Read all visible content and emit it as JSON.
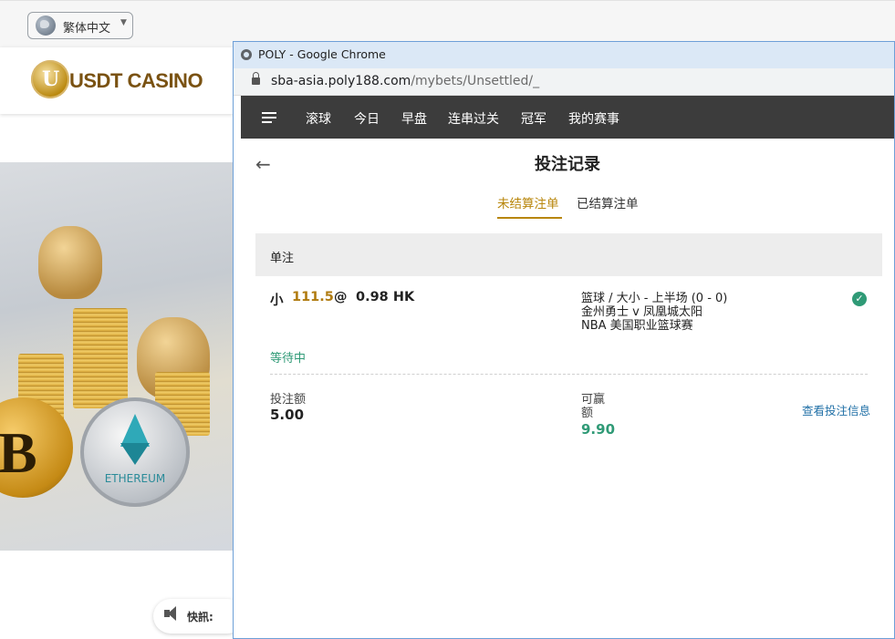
{
  "background_site": {
    "language_selector": {
      "label": "繁体中文",
      "icon": "globe-icon"
    },
    "logo_text": "USDT CASINO",
    "coin_labels": {
      "ethereum": "ETHEREUM",
      "bitcoin_symbol": "B"
    },
    "news_label": "快訊:"
  },
  "browser": {
    "window_title": "POLY - Google Chrome",
    "url_host": "sba-asia.poly188.com",
    "url_path": "/mybets/Unsettled/_"
  },
  "app_nav": {
    "items": [
      "滚球",
      "今日",
      "早盘",
      "连串过关",
      "冠军",
      "我的赛事"
    ]
  },
  "page": {
    "title": "投注记录",
    "tabs": [
      {
        "label": "未结算注单",
        "active": true
      },
      {
        "label": "已结算注单",
        "active": false
      }
    ],
    "section_label": "单注"
  },
  "bet": {
    "selection": "小",
    "line": "111.5",
    "at": "@",
    "odds": "0.98 HK",
    "market": "篮球 / 大小 - 上半场 (0 - 0)",
    "match": "金州勇士 v 凤凰城太阳",
    "league": "NBA 美国职业篮球赛",
    "status": "等待中",
    "stake_label": "投注额",
    "stake": "5.00",
    "win_label_line1": "可赢",
    "win_label_line2": "额",
    "win_amount": "9.90",
    "details_link": "查看投注信息"
  },
  "colors": {
    "accent": "#b8860b",
    "success": "#2f9a76",
    "nav_bg": "#3c3c3c",
    "link": "#1f6fa6"
  }
}
